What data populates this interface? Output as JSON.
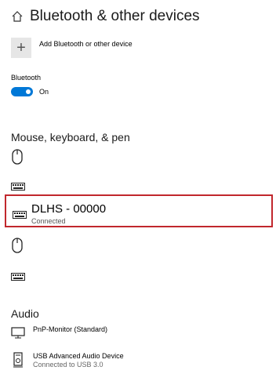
{
  "header": {
    "title": "Bluetooth & other devices",
    "home_icon": "home-icon"
  },
  "add_device": {
    "label": "Add Bluetooth or other device",
    "icon": "plus-icon"
  },
  "bluetooth": {
    "label": "Bluetooth",
    "state": "On",
    "accent": "#0078d7"
  },
  "sections": {
    "mouse_keyboard_pen": "Mouse, keyboard, & pen",
    "audio": "Audio"
  },
  "devices": {
    "highlighted": {
      "name": "DLHS - 00000",
      "status": "Connected",
      "border_color": "#c1272d"
    }
  },
  "audio_devices": [
    {
      "name": "PnP-Monitor (Standard)",
      "status": ""
    },
    {
      "name": "USB Advanced Audio Device",
      "status": "Connected to USB 3.0"
    }
  ]
}
